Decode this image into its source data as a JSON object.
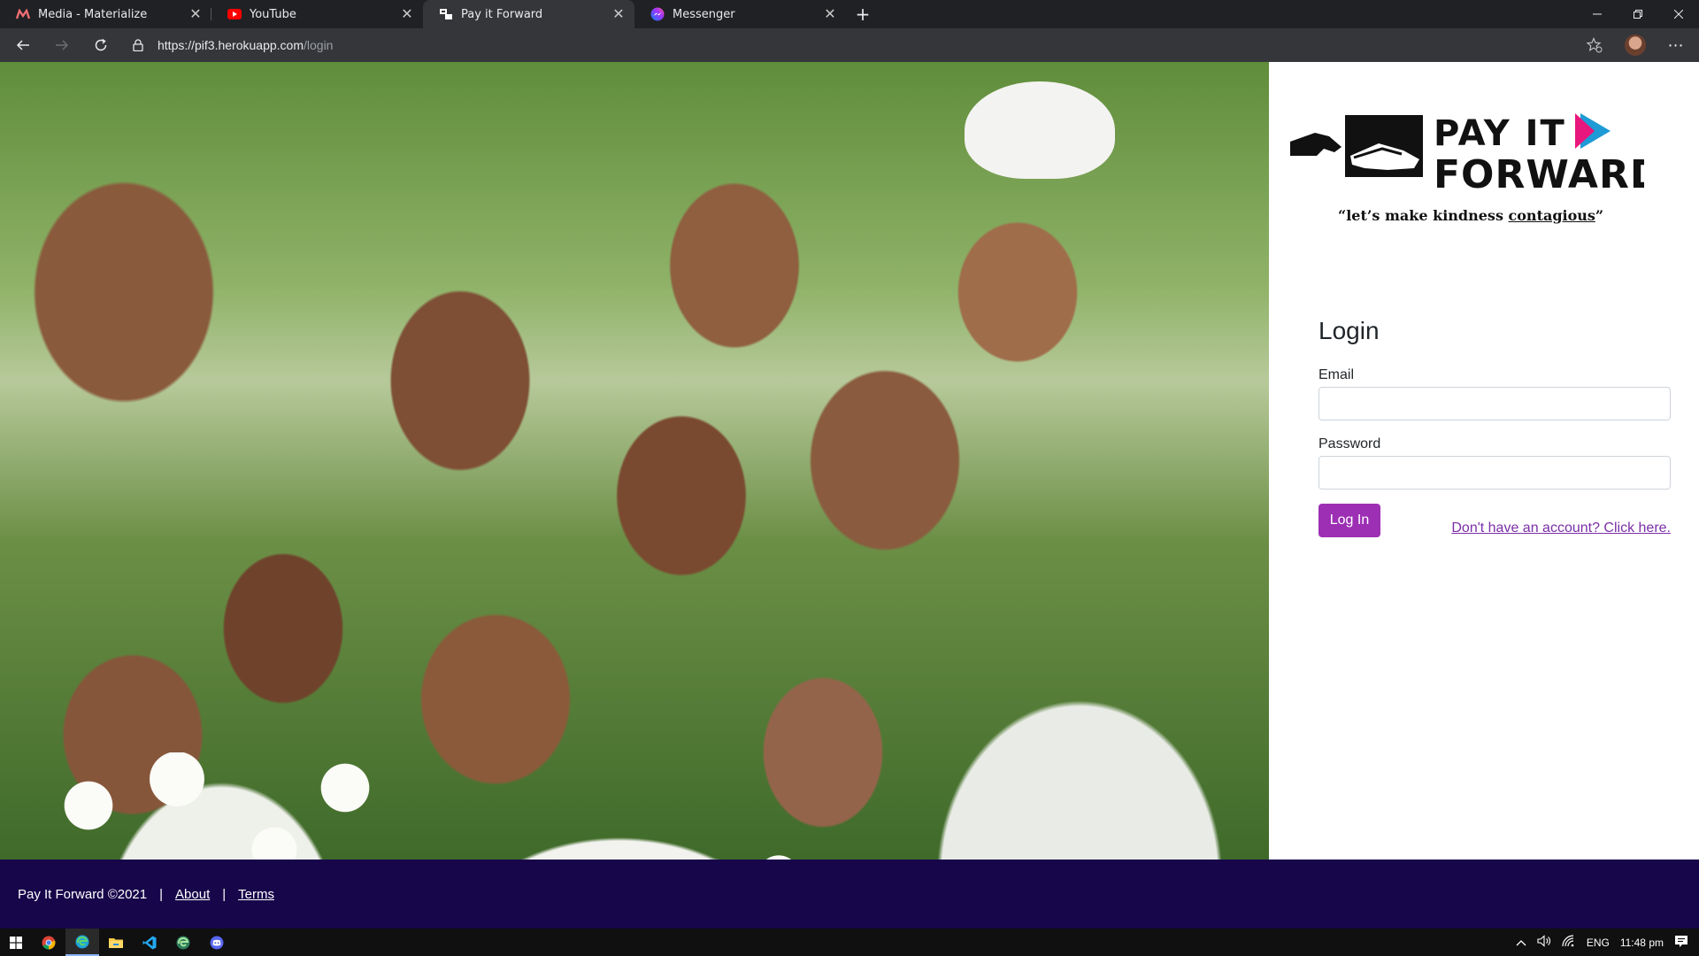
{
  "browser": {
    "tabs": [
      {
        "title": "Media - Materialize",
        "icon": "materialize-icon",
        "active": false
      },
      {
        "title": "YouTube",
        "icon": "youtube-icon",
        "active": false
      },
      {
        "title": "Pay it Forward",
        "icon": "payitforward-icon",
        "active": true
      },
      {
        "title": "Messenger",
        "icon": "messenger-icon",
        "active": false
      }
    ],
    "url_host": "https://pif3.herokuapp.com",
    "url_path": "/login"
  },
  "brand": {
    "logo_line1": "PAY IT",
    "logo_line2": "FORWARD",
    "tagline_pre": "“let’s make kindness ",
    "tagline_emph": "contagious",
    "tagline_post": "”"
  },
  "login": {
    "title": "Login",
    "email_label": "Email",
    "email_value": "",
    "password_label": "Password",
    "password_value": "",
    "submit_label": "Log In",
    "signup_link": "Don't have an account? Click here."
  },
  "footer": {
    "copyright": "Pay It Forward ©2021",
    "separator": "|",
    "about": "About",
    "terms": "Terms"
  },
  "taskbar": {
    "language": "ENG",
    "time": "11:48 pm"
  },
  "colors": {
    "accent": "#9c2fb3",
    "footer_bg": "#17064a",
    "link": "#7b2fa8"
  }
}
